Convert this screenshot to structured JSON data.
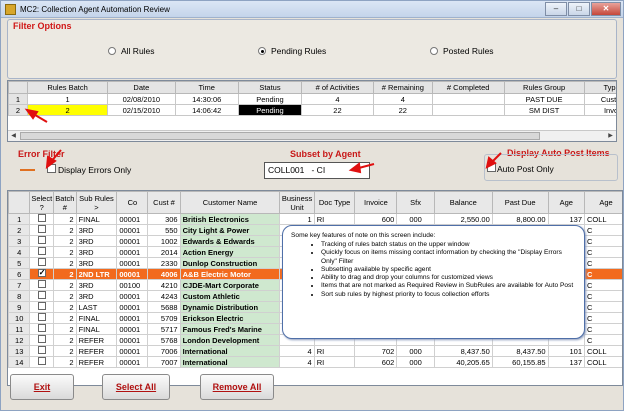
{
  "window": {
    "title": "MC2: Collection Agent Automation Review"
  },
  "filter_options": {
    "header": "Filter Options",
    "radios": [
      {
        "label": "All Rules",
        "selected": false
      },
      {
        "label": "Pending Rules",
        "selected": true
      },
      {
        "label": "Posted Rules",
        "selected": false
      }
    ]
  },
  "batch_table": {
    "columns": [
      "Rules Batch",
      "Date",
      "Time",
      "Status",
      "# of Activities",
      "# Remaining",
      "# Completed",
      "Rules Group",
      "Type of"
    ],
    "rows": [
      {
        "rn": "1",
        "cells": [
          "1",
          "02/08/2010",
          "14:30:06",
          "Pending",
          "4",
          "4",
          "",
          "PAST DUE",
          "Custome"
        ]
      },
      {
        "rn": "2",
        "cells": [
          "2",
          "02/15/2010",
          "14:06:42",
          "Pending",
          "22",
          "22",
          "",
          "SM DIST",
          "Invoice"
        ]
      }
    ]
  },
  "error_filter": {
    "header": "Error Filter",
    "checkbox_label": "Display Errors Only",
    "checked": false
  },
  "subset_agent": {
    "header": "Subset by Agent",
    "code": "COLL001",
    "name": "- CI"
  },
  "auto_post": {
    "header": "Display Auto Post Items",
    "checkbox_label": "Auto Post Only",
    "checked": false
  },
  "grid": {
    "columns": [
      "",
      "Select ?",
      "Batch #",
      "Sub Rules >",
      "Co",
      "Cust #",
      "Customer Name",
      "Business Unit",
      "Doc Type",
      "Invoice",
      "Sfx",
      "Balance",
      "Past Due",
      "Age",
      "Age"
    ],
    "rows": [
      {
        "rn": "1",
        "sel": false,
        "batch": "2",
        "sub": "FINAL",
        "co": "00001",
        "cust": "306",
        "name": "British Electronics",
        "bu": "1",
        "doc": "RI",
        "inv": "600",
        "sfx": "000",
        "bal": "2,550.00",
        "pd": "8,800.00",
        "age": "137",
        "age2": "COLL"
      },
      {
        "rn": "2",
        "sel": false,
        "batch": "2",
        "sub": "3RD",
        "co": "00001",
        "cust": "550",
        "name": "City Light & Power",
        "bu": "",
        "doc": "",
        "inv": "",
        "sfx": "",
        "bal": "",
        "pd": "",
        "age": "",
        "age2": "C"
      },
      {
        "rn": "3",
        "sel": false,
        "batch": "2",
        "sub": "3RD",
        "co": "00001",
        "cust": "1002",
        "name": "Edwards & Edwards",
        "bu": "",
        "doc": "",
        "inv": "",
        "sfx": "",
        "bal": "",
        "pd": "",
        "age": "",
        "age2": "C"
      },
      {
        "rn": "4",
        "sel": false,
        "batch": "2",
        "sub": "3RD",
        "co": "00001",
        "cust": "2014",
        "name": "Action Energy",
        "bu": "",
        "doc": "",
        "inv": "",
        "sfx": "",
        "bal": "",
        "pd": "",
        "age": "",
        "age2": "C"
      },
      {
        "rn": "5",
        "sel": false,
        "batch": "2",
        "sub": "3RD",
        "co": "00001",
        "cust": "2330",
        "name": "Dunlop Construction",
        "bu": "",
        "doc": "",
        "inv": "",
        "sfx": "",
        "bal": "",
        "pd": "",
        "age": "",
        "age2": "C"
      },
      {
        "rn": "6",
        "sel": true,
        "batch": "2",
        "sub": "2ND LTR",
        "co": "00001",
        "cust": "4006",
        "name": "A&B Electric Motor",
        "bu": "",
        "doc": "",
        "inv": "",
        "sfx": "",
        "bal": "",
        "pd": "",
        "age": "",
        "age2": "C",
        "hl": true
      },
      {
        "rn": "7",
        "sel": false,
        "batch": "2",
        "sub": "3RD",
        "co": "00100",
        "cust": "4210",
        "name": "CJDE-Mart Corporate",
        "bu": "",
        "doc": "",
        "inv": "",
        "sfx": "",
        "bal": "",
        "pd": "",
        "age": "",
        "age2": "C"
      },
      {
        "rn": "8",
        "sel": false,
        "batch": "2",
        "sub": "3RD",
        "co": "00001",
        "cust": "4243",
        "name": "Custom Athletic",
        "bu": "",
        "doc": "",
        "inv": "",
        "sfx": "",
        "bal": "",
        "pd": "",
        "age": "",
        "age2": "C"
      },
      {
        "rn": "9",
        "sel": false,
        "batch": "2",
        "sub": "LAST",
        "co": "00001",
        "cust": "5688",
        "name": "Dynamic Distribution",
        "bu": "",
        "doc": "",
        "inv": "",
        "sfx": "",
        "bal": "",
        "pd": "",
        "age": "",
        "age2": "C"
      },
      {
        "rn": "10",
        "sel": false,
        "batch": "2",
        "sub": "FINAL",
        "co": "00001",
        "cust": "5709",
        "name": "Erickson Electric",
        "bu": "",
        "doc": "",
        "inv": "",
        "sfx": "",
        "bal": "",
        "pd": "",
        "age": "",
        "age2": "C"
      },
      {
        "rn": "11",
        "sel": false,
        "batch": "2",
        "sub": "FINAL",
        "co": "00001",
        "cust": "5717",
        "name": "Famous Fred's Marine",
        "bu": "",
        "doc": "",
        "inv": "",
        "sfx": "",
        "bal": "",
        "pd": "",
        "age": "",
        "age2": "C"
      },
      {
        "rn": "12",
        "sel": false,
        "batch": "2",
        "sub": "REFER",
        "co": "00001",
        "cust": "5768",
        "name": "London Development",
        "bu": "",
        "doc": "",
        "inv": "",
        "sfx": "",
        "bal": "",
        "pd": "",
        "age": "",
        "age2": "C"
      },
      {
        "rn": "13",
        "sel": false,
        "batch": "2",
        "sub": "REFER",
        "co": "00001",
        "cust": "7006",
        "name": "International",
        "bu": "4",
        "doc": "RI",
        "inv": "702",
        "sfx": "000",
        "bal": "8,437.50",
        "pd": "8,437.50",
        "age": "101",
        "age2": "COLL"
      },
      {
        "rn": "14",
        "sel": false,
        "batch": "2",
        "sub": "REFER",
        "co": "00001",
        "cust": "7007",
        "name": "International",
        "bu": "4",
        "doc": "RI",
        "inv": "602",
        "sfx": "000",
        "bal": "40,205.65",
        "pd": "60,155.85",
        "age": "137",
        "age2": "COLL"
      }
    ]
  },
  "note": {
    "intro": "Some key features of note on this screen include:",
    "items": [
      "Tracking of rules batch status on the upper window",
      "Quickly focus on items missing contact information by checking the \"Display Errors Only\" Filter",
      "Subsetting available by specific agent",
      "Ability to drag and drop your columns for customized views",
      "Items that are not marked as Required Review in SubRules are available for Auto Post",
      "Sort sub rules by highest priority to focus collection efforts"
    ]
  },
  "buttons": {
    "exit": "Exit",
    "select_all": "Select All",
    "remove_all": "Remove All"
  }
}
